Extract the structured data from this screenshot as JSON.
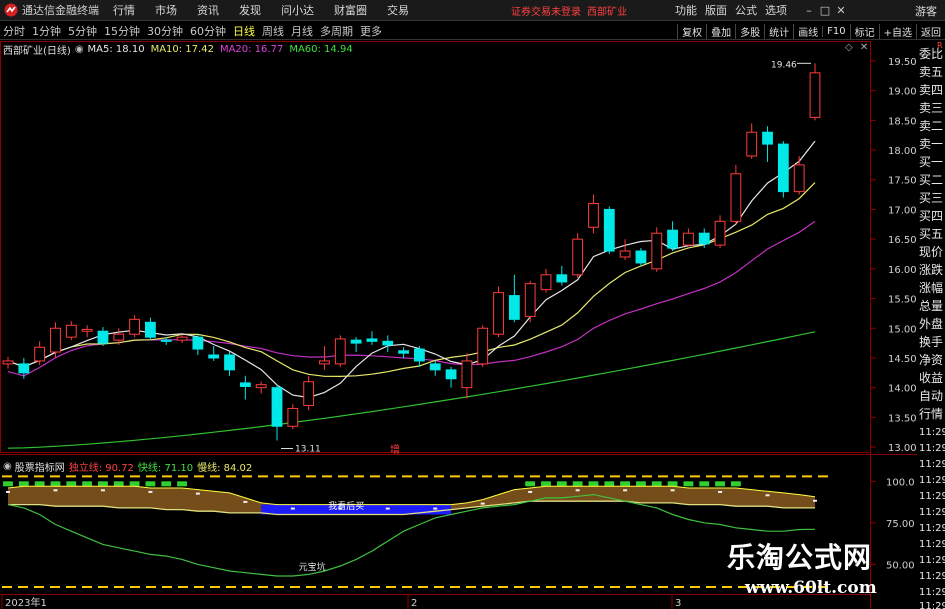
{
  "window": {
    "app_title": "通达信金融终端",
    "menu": [
      "行情",
      "市场",
      "资讯",
      "发现",
      "问小达",
      "财富圈",
      "交易"
    ],
    "status_login": "证券交易未登录",
    "status_stock": "西部矿业",
    "right_menu": [
      "功能",
      "版面",
      "公式",
      "选项"
    ],
    "guest": "游客"
  },
  "periods": {
    "items": [
      "分时",
      "1分钟",
      "5分钟",
      "15分钟",
      "30分钟",
      "60分钟",
      "日线",
      "周线",
      "月线",
      "多周期",
      "更多"
    ],
    "active": "日线",
    "right_buttons": [
      "复权",
      "叠加",
      "多股",
      "统计",
      "画线",
      "F10",
      "标记",
      "+自选",
      "返回"
    ]
  },
  "main_chart": {
    "stock_label": "西部矿业(日线)",
    "ma5": "MA5: 18.10",
    "ma10": "MA10: 17.42",
    "ma20": "MA20: 16.77",
    "ma60": "MA60: 14.94",
    "high_label": "19.46",
    "low_label": "13.11",
    "increase_tag": "增",
    "y_ticks": [
      "19.50",
      "19.00",
      "18.50",
      "18.00",
      "17.50",
      "17.00",
      "16.50",
      "16.00",
      "15.50",
      "15.00",
      "14.50",
      "14.00",
      "13.50",
      "13.00"
    ]
  },
  "sub_chart": {
    "indicator_name": "股票指标网",
    "v1": "独立线: 90.72",
    "v2": "快线: 71.10",
    "v3": "慢线: 84.02",
    "label_buy": "我看后买",
    "label_pit": "元宝坑",
    "y_ticks": [
      "100.0",
      "75.00",
      "50.00"
    ]
  },
  "time_axis": [
    "2023年1",
    "2",
    "3"
  ],
  "side_panel": {
    "items": [
      "委比",
      "卖五",
      "卖四",
      "卖三",
      "卖二",
      "卖一",
      "买一",
      "买二",
      "买三",
      "买四",
      "买五",
      "现价",
      "涨跌",
      "涨幅",
      "总量",
      "外盘",
      "换手",
      "净资",
      "收益",
      "自动",
      "行情"
    ],
    "times": [
      "11:29",
      "11:29",
      "11:29",
      "11:29",
      "11:29",
      "11:29",
      "11:29",
      "11:29",
      "11:29",
      "11:29",
      "11:29",
      "11:29"
    ],
    "small_tag": "R"
  },
  "watermark": {
    "cn": "乐淘公式网",
    "url": "www.60lt.com"
  },
  "colors": {
    "up": "#ff3c3c",
    "down": "#00e8e8",
    "ma5": "#e6e6e6",
    "ma10": "#e8e86a",
    "ma20": "#c030c0",
    "ma60": "#30c030",
    "fast_line": "#40c040",
    "indep_line": "#ffff40",
    "slow_line": "#e0e080",
    "blue_area": "#1c1cff",
    "brown_area": "#8a5a20",
    "dashed": "#ffcc00"
  },
  "chart_data": {
    "type": "candlestick",
    "title": "西部矿业(日线)",
    "ylim": [
      12.9,
      19.6
    ],
    "candles": [
      {
        "o": 14.4,
        "c": 14.45,
        "h": 14.52,
        "l": 14.32
      },
      {
        "o": 14.4,
        "c": 14.25,
        "h": 14.5,
        "l": 14.15
      },
      {
        "o": 14.45,
        "c": 14.68,
        "h": 14.78,
        "l": 14.38
      },
      {
        "o": 14.6,
        "c": 15.0,
        "h": 15.1,
        "l": 14.5
      },
      {
        "o": 14.85,
        "c": 15.05,
        "h": 15.12,
        "l": 14.8
      },
      {
        "o": 14.95,
        "c": 14.98,
        "h": 15.05,
        "l": 14.85
      },
      {
        "o": 14.95,
        "c": 14.75,
        "h": 15.02,
        "l": 14.7
      },
      {
        "o": 14.8,
        "c": 14.9,
        "h": 15.0,
        "l": 14.72
      },
      {
        "o": 14.9,
        "c": 15.15,
        "h": 15.22,
        "l": 14.85
      },
      {
        "o": 15.1,
        "c": 14.85,
        "h": 15.18,
        "l": 14.8
      },
      {
        "o": 14.8,
        "c": 14.78,
        "h": 14.85,
        "l": 14.72
      },
      {
        "o": 14.8,
        "c": 14.85,
        "h": 14.9,
        "l": 14.75
      },
      {
        "o": 14.85,
        "c": 14.65,
        "h": 14.9,
        "l": 14.55
      },
      {
        "o": 14.55,
        "c": 14.5,
        "h": 14.7,
        "l": 14.45
      },
      {
        "o": 14.55,
        "c": 14.3,
        "h": 14.6,
        "l": 14.2
      },
      {
        "o": 14.08,
        "c": 14.02,
        "h": 14.2,
        "l": 13.8
      },
      {
        "o": 14.0,
        "c": 14.05,
        "h": 14.1,
        "l": 13.9
      },
      {
        "o": 14.0,
        "c": 13.35,
        "h": 14.05,
        "l": 13.11
      },
      {
        "o": 13.35,
        "c": 13.65,
        "h": 13.72,
        "l": 13.3
      },
      {
        "o": 13.7,
        "c": 14.1,
        "h": 14.2,
        "l": 13.62
      },
      {
        "o": 14.4,
        "c": 14.45,
        "h": 14.7,
        "l": 14.3
      },
      {
        "o": 14.4,
        "c": 14.82,
        "h": 14.88,
        "l": 14.35
      },
      {
        "o": 14.8,
        "c": 14.75,
        "h": 14.85,
        "l": 14.6
      },
      {
        "o": 14.82,
        "c": 14.78,
        "h": 14.95,
        "l": 14.72
      },
      {
        "o": 14.78,
        "c": 14.72,
        "h": 14.88,
        "l": 14.6
      },
      {
        "o": 14.62,
        "c": 14.58,
        "h": 14.68,
        "l": 14.5
      },
      {
        "o": 14.65,
        "c": 14.45,
        "h": 14.7,
        "l": 14.35
      },
      {
        "o": 14.4,
        "c": 14.3,
        "h": 14.45,
        "l": 14.2
      },
      {
        "o": 14.3,
        "c": 14.15,
        "h": 14.35,
        "l": 14.0
      },
      {
        "o": 14.0,
        "c": 14.45,
        "h": 14.58,
        "l": 13.82
      },
      {
        "o": 14.4,
        "c": 15.0,
        "h": 15.05,
        "l": 14.35
      },
      {
        "o": 14.9,
        "c": 15.6,
        "h": 15.7,
        "l": 14.85
      },
      {
        "o": 15.55,
        "c": 15.15,
        "h": 15.9,
        "l": 15.1
      },
      {
        "o": 15.2,
        "c": 15.75,
        "h": 15.8,
        "l": 15.1
      },
      {
        "o": 15.65,
        "c": 15.9,
        "h": 16.0,
        "l": 15.6
      },
      {
        "o": 15.9,
        "c": 15.78,
        "h": 16.05,
        "l": 15.72
      },
      {
        "o": 15.9,
        "c": 16.5,
        "h": 16.6,
        "l": 15.85
      },
      {
        "o": 16.7,
        "c": 17.1,
        "h": 17.25,
        "l": 16.6
      },
      {
        "o": 17.0,
        "c": 16.3,
        "h": 17.05,
        "l": 16.25
      },
      {
        "o": 16.2,
        "c": 16.3,
        "h": 16.5,
        "l": 16.15
      },
      {
        "o": 16.3,
        "c": 16.1,
        "h": 16.35,
        "l": 16.05
      },
      {
        "o": 16.0,
        "c": 16.6,
        "h": 16.7,
        "l": 15.95
      },
      {
        "o": 16.65,
        "c": 16.35,
        "h": 16.8,
        "l": 16.3
      },
      {
        "o": 16.4,
        "c": 16.6,
        "h": 16.68,
        "l": 16.38
      },
      {
        "o": 16.6,
        "c": 16.42,
        "h": 16.68,
        "l": 16.35
      },
      {
        "o": 16.4,
        "c": 16.8,
        "h": 16.9,
        "l": 16.35
      },
      {
        "o": 16.8,
        "c": 17.6,
        "h": 17.75,
        "l": 16.75
      },
      {
        "o": 17.9,
        "c": 18.3,
        "h": 18.45,
        "l": 17.85
      },
      {
        "o": 18.3,
        "c": 18.1,
        "h": 18.4,
        "l": 17.8
      },
      {
        "o": 18.1,
        "c": 17.3,
        "h": 18.15,
        "l": 17.2
      },
      {
        "o": 17.3,
        "c": 17.75,
        "h": 17.9,
        "l": 17.25
      },
      {
        "o": 18.55,
        "c": 19.3,
        "h": 19.46,
        "l": 18.5
      }
    ]
  }
}
